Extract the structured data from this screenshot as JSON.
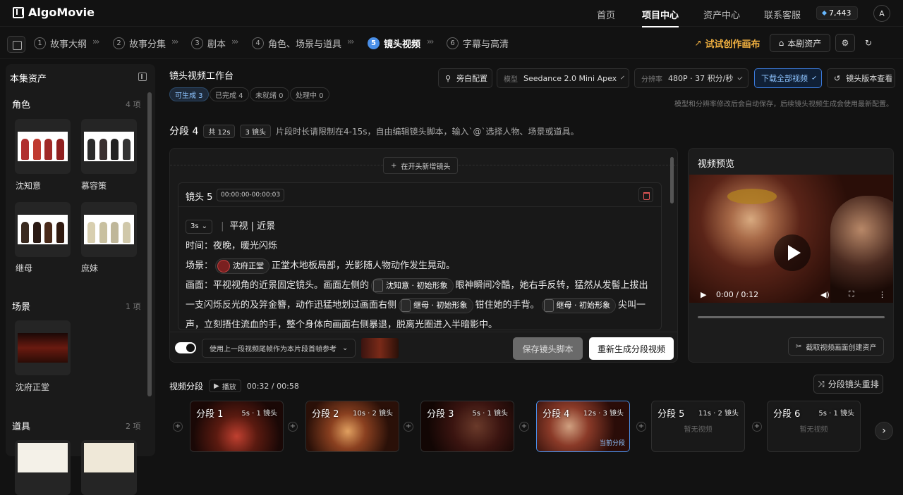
{
  "app": {
    "name": "AlgoMovie"
  },
  "nav": {
    "items": [
      "首页",
      "项目中心",
      "资产中心",
      "联系客服"
    ],
    "active": "项目中心",
    "credits": "7,443",
    "avatar": "A"
  },
  "steps": [
    {
      "num": "1",
      "label": "故事大纲"
    },
    {
      "num": "2",
      "label": "故事分集"
    },
    {
      "num": "3",
      "label": "剧本"
    },
    {
      "num": "4",
      "label": "角色、场景与道具"
    },
    {
      "num": "5",
      "label": "镜头视频",
      "active": true
    },
    {
      "num": "6",
      "label": "字幕与高清"
    }
  ],
  "step_sep": "›››",
  "toolbar": {
    "trial": "试试创作画布",
    "assets": "本剧资产"
  },
  "sidebar": {
    "title": "本集资产",
    "roles": {
      "label": "角色",
      "count": "4 项",
      "items": [
        "沈知意",
        "慕容策",
        "继母",
        "庶妹"
      ]
    },
    "scenes": {
      "label": "场景",
      "count": "1 项",
      "items": [
        "沈府正堂"
      ]
    },
    "props": {
      "label": "道具",
      "count": "2 项"
    }
  },
  "workbench": {
    "title": "镜头视频工作台",
    "badges": [
      "可生成 3",
      "已完成 4",
      "未就绪 0",
      "处理中 0"
    ],
    "voiceover_btn": "旁白配置",
    "model_label": "模型",
    "model_value": "Seedance 2.0 Mini Apex",
    "res_label": "分辨率",
    "res_value": "480P · 37 积分/秒",
    "download_btn": "下载全部视频",
    "version_btn": "镜头版本查看",
    "hint": "模型和分辨率修改后会自动保存，后续镜头视频生成会使用最新配置。"
  },
  "segment": {
    "title": "分段 4",
    "total": "共 12s",
    "shots": "3 镜头",
    "desc": "片段时长请限制在4-15s，自由编辑镜头脚本，输入`@`选择人物、场景或道具。"
  },
  "editor": {
    "add_head": "在开头新增镜头",
    "shot_title": "镜头 5",
    "timecode": "00:00:00-00:00:03",
    "duration": "3s",
    "shot_type": "平视 | 近景",
    "time_line": "时间：夜晚，暖光闪烁",
    "scene_prefix": "场景：",
    "scene_tag": "沈府正堂",
    "scene_suffix": "正堂木地板局部，光影随人物动作发生晃动。",
    "visual_prefix": "画面：平视视角的近景固定镜头。画面左侧的",
    "tag1": "沈知意 · 初始形象",
    "visual_mid1": "眼神瞬间冷酷，她右手反转，猛然从发髻上拔出一支闪烁反光的及笄金簪，动作迅猛地划过画面右侧",
    "tag2": "继母 · 初始形象",
    "visual_mid2": "钳住她的手背。",
    "tag3": "继母 · 初始形象",
    "visual_end": "尖叫一声，立刻捂住流血的手，整个身体向画面右侧暴退，脱离光圈进入半暗影中。",
    "ref_select": "使用上一段视频尾帧作为本片段首帧参考",
    "save_btn": "保存镜头脚本",
    "regen_btn": "重新生成分段视频"
  },
  "preview": {
    "title": "视频预览",
    "time": "0:00 / 0:12",
    "capture_btn": "截取视频画面创建资产"
  },
  "timeline": {
    "title": "视频分段",
    "play": "播放",
    "time": "00:32 / 00:58",
    "rearrange": "分段镜头重排",
    "current_tag": "当前分段",
    "empty_text": "暂无视频",
    "segments": [
      {
        "name": "分段 1",
        "meta": "5s · 1 镜头"
      },
      {
        "name": "分段 2",
        "meta": "10s · 2 镜头"
      },
      {
        "name": "分段 3",
        "meta": "5s · 1 镜头"
      },
      {
        "name": "分段 4",
        "meta": "12s · 3 镜头"
      },
      {
        "name": "分段 5",
        "meta": "11s · 2 镜头"
      },
      {
        "name": "分段 6",
        "meta": "5s · 1 镜头"
      }
    ]
  },
  "colors": {
    "accent": "#4a8fe7",
    "trial": "#f0b040",
    "bg": "#121212"
  }
}
